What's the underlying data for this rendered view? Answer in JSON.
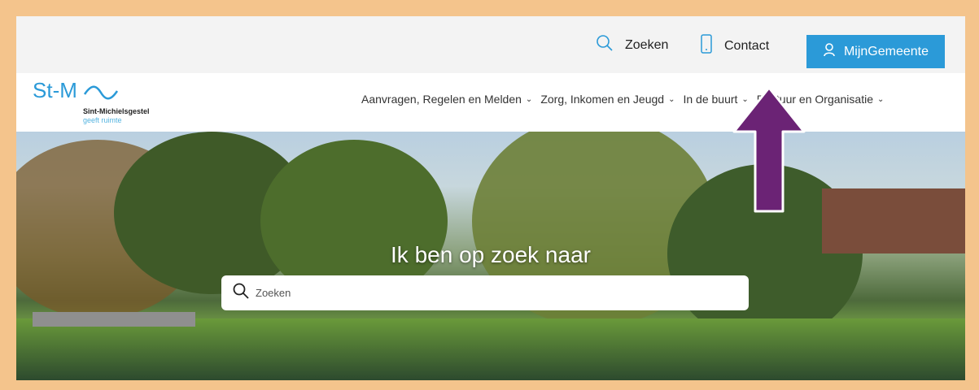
{
  "topbar": {
    "search_label": "Zoeken",
    "contact_label": "Contact",
    "mijn_label": "MijnGemeente"
  },
  "logo": {
    "mark": "St-M",
    "name": "Sint-Michielsgestel",
    "tagline": "geeft ruimte"
  },
  "nav": {
    "items": [
      {
        "label": "Aanvragen, Regelen en Melden"
      },
      {
        "label": "Zorg, Inkomen en Jeugd"
      },
      {
        "label": "In de buurt"
      },
      {
        "label": "Bestuur en Organisatie"
      }
    ]
  },
  "hero": {
    "title": "Ik ben op zoek naar",
    "search_placeholder": "Zoeken"
  },
  "colors": {
    "frame": "#f4c48c",
    "accent": "#2b9ad8",
    "arrow": "#6b2375"
  }
}
